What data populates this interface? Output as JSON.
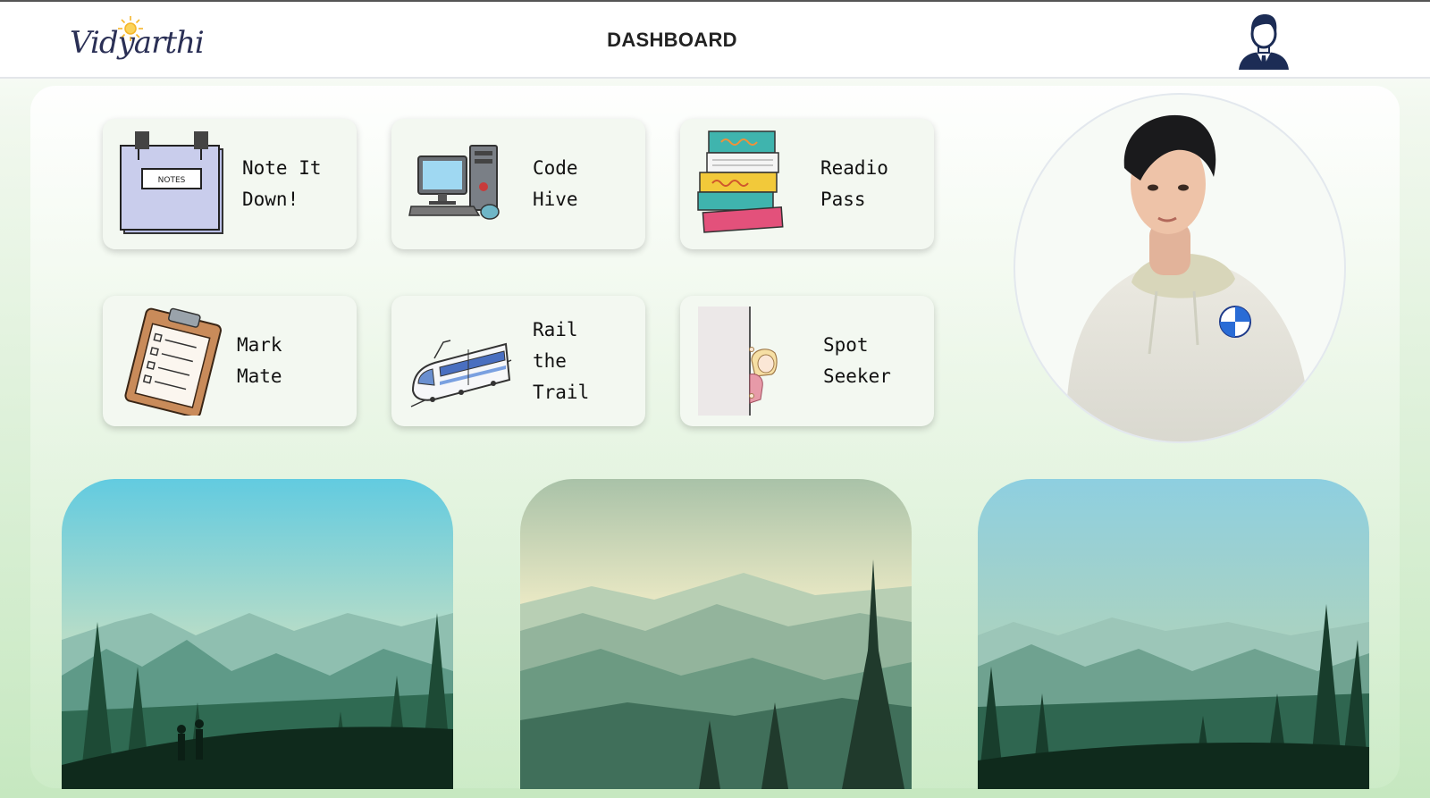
{
  "header": {
    "logo_text": "Vidyarthi",
    "title": "DASHBOARD",
    "profile_icon": "user-profile-icon"
  },
  "cards": [
    {
      "id": "note-it-down",
      "label": "Note It\nDown!",
      "icon": "notes-board-icon"
    },
    {
      "id": "code-hive",
      "label": "Code\nHive",
      "icon": "desktop-computer-icon"
    },
    {
      "id": "readio-pass",
      "label": "Readio\nPass",
      "icon": "book-stack-icon"
    },
    {
      "id": "mark-mate",
      "label": "Mark\nMate",
      "icon": "clipboard-checklist-icon"
    },
    {
      "id": "rail-the-trail",
      "label": "Rail\nthe\nTrail",
      "icon": "train-icon"
    },
    {
      "id": "spot-seeker",
      "label": "Spot\nSeeker",
      "icon": "peeking-girl-icon"
    }
  ],
  "avatar": {
    "icon": "student-avatar"
  },
  "scenes": [
    {
      "id": "scene-1",
      "icon": "mountain-hikers-landscape"
    },
    {
      "id": "scene-2",
      "icon": "misty-mountains-landscape"
    },
    {
      "id": "scene-3",
      "icon": "forest-mountains-landscape"
    }
  ],
  "colors": {
    "header_bg": "#ffffff",
    "card_bg": "#f3f8f1",
    "page_gradient_bottom": "#c6e8c0",
    "title_text": "#222222",
    "logo_ink": "#2a2f55",
    "sun_accent": "#f5b62a"
  }
}
